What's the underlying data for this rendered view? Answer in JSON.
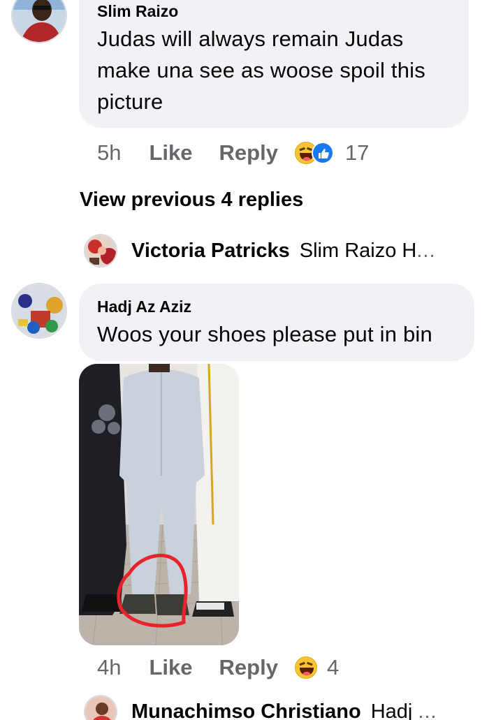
{
  "comment1": {
    "author": "Slim Raizo",
    "lines": [
      "Judas will always remain Judas",
      "make una see as woose spoil this",
      "picture"
    ],
    "time": "5h",
    "like_label": "Like",
    "reply_label": "Reply",
    "reaction_icons": [
      "haha-emoji-icon",
      "like-thumb-icon"
    ],
    "reaction_count": "17"
  },
  "view_previous": "View previous 4 replies",
  "reply_preview_1": {
    "author": "Victoria Patricks",
    "text": "Slim Raizo H",
    "ellipsis": "..."
  },
  "comment2": {
    "author": "Hadj Az Aziz",
    "text": "Woos your shoes please put in bin",
    "time": "4h",
    "like_label": "Like",
    "reply_label": "Reply",
    "reaction_icons": [
      "haha-emoji-icon"
    ],
    "reaction_count": "4"
  },
  "reply_preview_2": {
    "author": "Munachimso Christiano",
    "text": "Hadj",
    "ellipsis": "..."
  },
  "colors": {
    "bubble": "#f0f2f5",
    "meta_text": "#65676b",
    "like_blue": "#1877f2",
    "haha_yellow": "#f7c433",
    "annotation_red": "#e8232b"
  }
}
